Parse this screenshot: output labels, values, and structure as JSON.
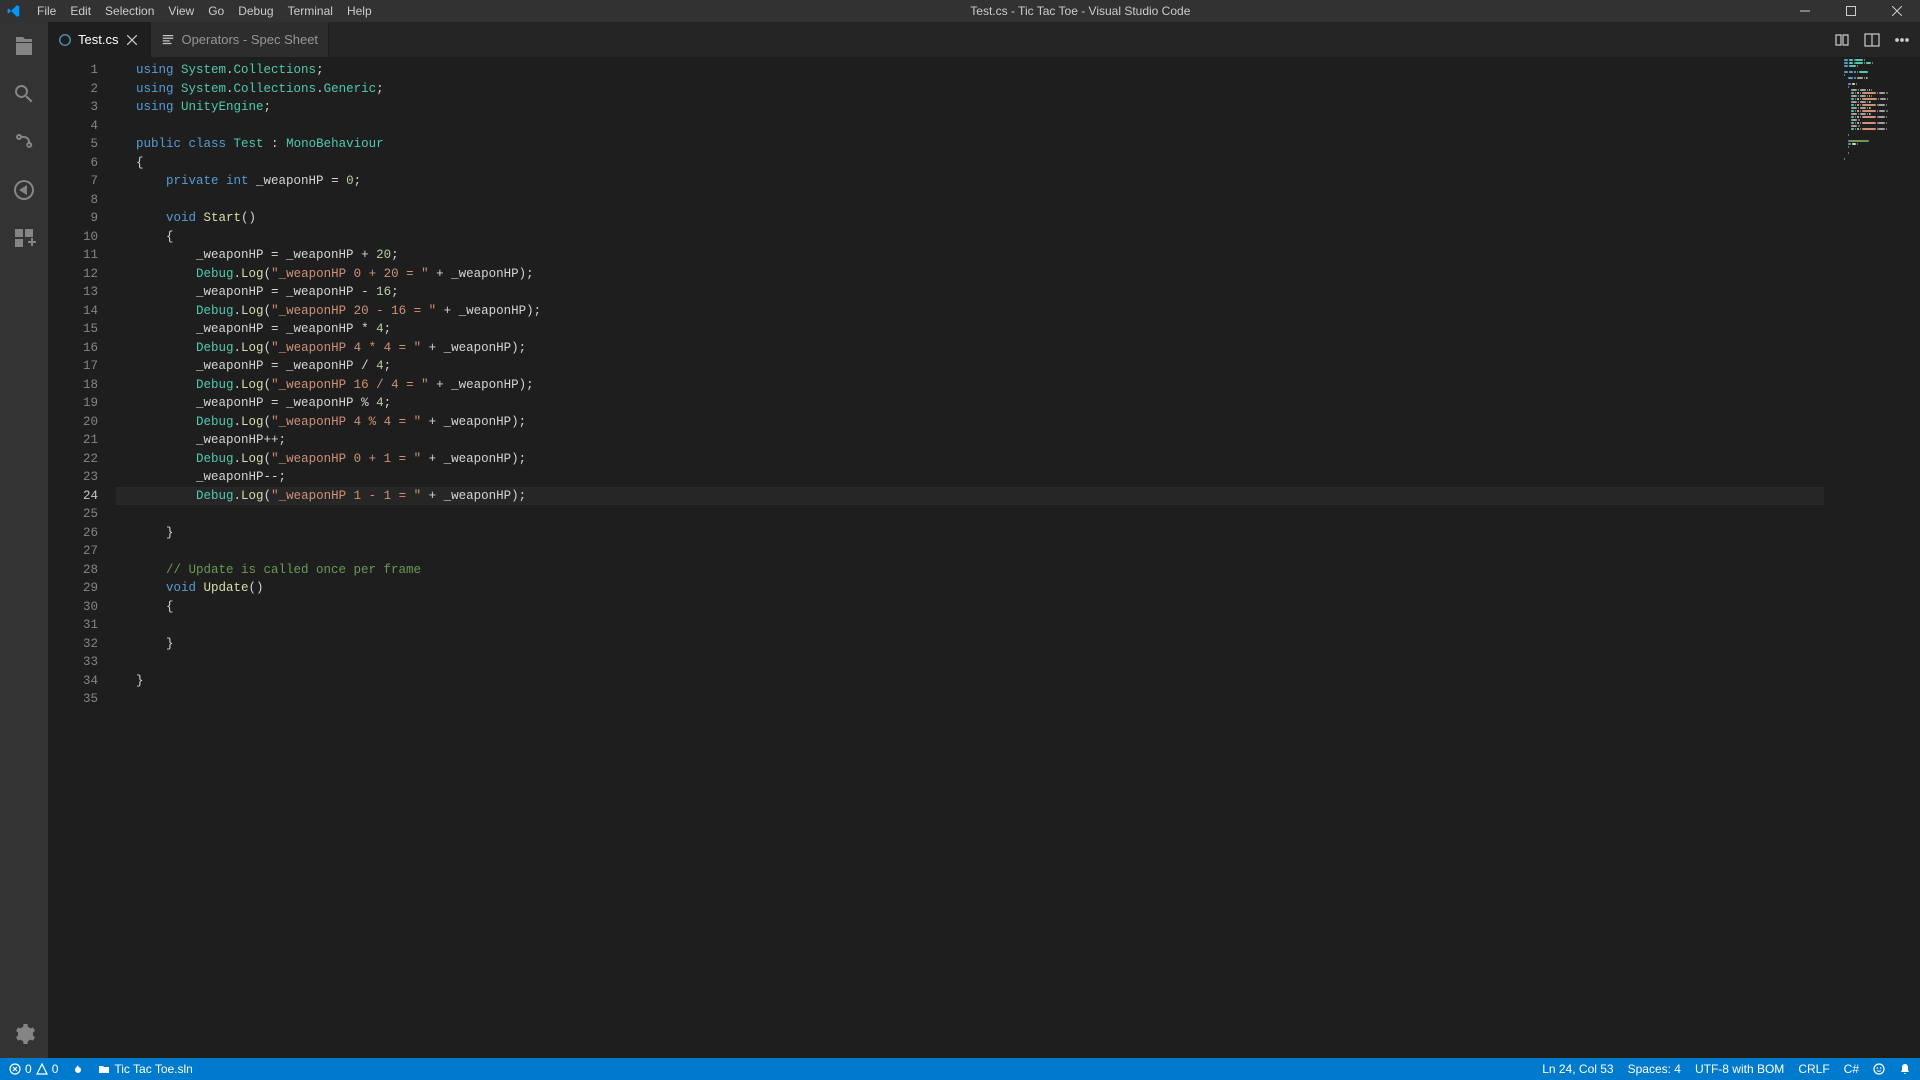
{
  "window": {
    "title": "Test.cs - Tic Tac Toe - Visual Studio Code"
  },
  "menu": {
    "file": "File",
    "edit": "Edit",
    "selection": "Selection",
    "view": "View",
    "go": "Go",
    "debug": "Debug",
    "terminal": "Terminal",
    "help": "Help"
  },
  "tabs": [
    {
      "label": "Test.cs",
      "active": true,
      "dirty": false
    },
    {
      "label": "Operators - Spec Sheet",
      "active": false,
      "dirty": false
    }
  ],
  "gutter": {
    "start": 1,
    "end": 35,
    "current": 24
  },
  "statusbar": {
    "errors": "0",
    "warnings": "0",
    "solution": "Tic Tac Toe.sln",
    "lncol": "Ln 24, Col 53",
    "spaces": "Spaces: 4",
    "encoding": "UTF-8 with BOM",
    "eol": "CRLF",
    "lang": "C#"
  },
  "code_raw": [
    "using System.Collections;",
    "using System.Collections.Generic;",
    "using UnityEngine;",
    "",
    "public class Test : MonoBehaviour",
    "{",
    "    private int _weaponHP = 0;",
    "",
    "    void Start()",
    "    {",
    "        _weaponHP = _weaponHP + 20;",
    "        Debug.Log(\"_weaponHP 0 + 20 = \" + _weaponHP);",
    "        _weaponHP = _weaponHP - 16;",
    "        Debug.Log(\"_weaponHP 20 - 16 = \" + _weaponHP);",
    "        _weaponHP = _weaponHP * 4;",
    "        Debug.Log(\"_weaponHP 4 * 4 = \" + _weaponHP);",
    "        _weaponHP = _weaponHP / 4;",
    "        Debug.Log(\"_weaponHP 16 / 4 = \" + _weaponHP);",
    "        _weaponHP = _weaponHP % 4;",
    "        Debug.Log(\"_weaponHP 4 % 4 = \" + _weaponHP);",
    "        _weaponHP++;",
    "        Debug.Log(\"_weaponHP 0 + 1 = \" + _weaponHP);",
    "        _weaponHP--;",
    "        Debug.Log(\"_weaponHP 1 - 1 = \" + _weaponHP);",
    "",
    "    }",
    "",
    "    // Update is called once per frame",
    "    void Update()",
    "    {",
    "",
    "    }",
    "",
    "}",
    ""
  ],
  "code": [
    [
      [
        "using ",
        "kw"
      ],
      [
        "System",
        "ns"
      ],
      [
        ".",
        "pun"
      ],
      [
        "Collections",
        "ns"
      ],
      [
        ";",
        "pun"
      ]
    ],
    [
      [
        "using ",
        "kw"
      ],
      [
        "System",
        "ns"
      ],
      [
        ".",
        "pun"
      ],
      [
        "Collections",
        "ns"
      ],
      [
        ".",
        "pun"
      ],
      [
        "Generic",
        "ns"
      ],
      [
        ";",
        "pun"
      ]
    ],
    [
      [
        "using ",
        "kw"
      ],
      [
        "UnityEngine",
        "ns"
      ],
      [
        ";",
        "pun"
      ]
    ],
    [],
    [
      [
        "public ",
        "kw"
      ],
      [
        "class ",
        "kw"
      ],
      [
        "Test",
        "cls"
      ],
      [
        " : ",
        "pun"
      ],
      [
        "MonoBehaviour",
        "cls"
      ]
    ],
    [
      [
        "{",
        "pun"
      ]
    ],
    [
      [
        "    ",
        "pun"
      ],
      [
        "private ",
        "kw"
      ],
      [
        "int ",
        "type"
      ],
      [
        "_weaponHP",
        "id"
      ],
      [
        " = ",
        "pun"
      ],
      [
        "0",
        "num"
      ],
      [
        ";",
        "pun"
      ]
    ],
    [],
    [
      [
        "    ",
        "pun"
      ],
      [
        "void ",
        "type"
      ],
      [
        "Start",
        "mtd"
      ],
      [
        "()",
        "pun"
      ]
    ],
    [
      [
        "    ",
        "pun"
      ],
      [
        "{",
        "pun"
      ]
    ],
    [
      [
        "        ",
        "pun"
      ],
      [
        "_weaponHP",
        "id"
      ],
      [
        " = ",
        "pun"
      ],
      [
        "_weaponHP",
        "id"
      ],
      [
        " + ",
        "pun"
      ],
      [
        "20",
        "num"
      ],
      [
        ";",
        "pun"
      ]
    ],
    [
      [
        "        ",
        "pun"
      ],
      [
        "Debug",
        "cls"
      ],
      [
        ".",
        "pun"
      ],
      [
        "Log",
        "mtd"
      ],
      [
        "(",
        "pun"
      ],
      [
        "\"_weaponHP 0 + 20 = \"",
        "str"
      ],
      [
        " + ",
        "pun"
      ],
      [
        "_weaponHP",
        "id"
      ],
      [
        ");",
        "pun"
      ]
    ],
    [
      [
        "        ",
        "pun"
      ],
      [
        "_weaponHP",
        "id"
      ],
      [
        " = ",
        "pun"
      ],
      [
        "_weaponHP",
        "id"
      ],
      [
        " - ",
        "pun"
      ],
      [
        "16",
        "num"
      ],
      [
        ";",
        "pun"
      ]
    ],
    [
      [
        "        ",
        "pun"
      ],
      [
        "Debug",
        "cls"
      ],
      [
        ".",
        "pun"
      ],
      [
        "Log",
        "mtd"
      ],
      [
        "(",
        "pun"
      ],
      [
        "\"_weaponHP 20 - 16 = \"",
        "str"
      ],
      [
        " + ",
        "pun"
      ],
      [
        "_weaponHP",
        "id"
      ],
      [
        ");",
        "pun"
      ]
    ],
    [
      [
        "        ",
        "pun"
      ],
      [
        "_weaponHP",
        "id"
      ],
      [
        " = ",
        "pun"
      ],
      [
        "_weaponHP",
        "id"
      ],
      [
        " * ",
        "pun"
      ],
      [
        "4",
        "num"
      ],
      [
        ";",
        "pun"
      ]
    ],
    [
      [
        "        ",
        "pun"
      ],
      [
        "Debug",
        "cls"
      ],
      [
        ".",
        "pun"
      ],
      [
        "Log",
        "mtd"
      ],
      [
        "(",
        "pun"
      ],
      [
        "\"_weaponHP 4 * 4 = \"",
        "str"
      ],
      [
        " + ",
        "pun"
      ],
      [
        "_weaponHP",
        "id"
      ],
      [
        ");",
        "pun"
      ]
    ],
    [
      [
        "        ",
        "pun"
      ],
      [
        "_weaponHP",
        "id"
      ],
      [
        " = ",
        "pun"
      ],
      [
        "_weaponHP",
        "id"
      ],
      [
        " / ",
        "pun"
      ],
      [
        "4",
        "num"
      ],
      [
        ";",
        "pun"
      ]
    ],
    [
      [
        "        ",
        "pun"
      ],
      [
        "Debug",
        "cls"
      ],
      [
        ".",
        "pun"
      ],
      [
        "Log",
        "mtd"
      ],
      [
        "(",
        "pun"
      ],
      [
        "\"_weaponHP 16 / 4 = \"",
        "str"
      ],
      [
        " + ",
        "pun"
      ],
      [
        "_weaponHP",
        "id"
      ],
      [
        ");",
        "pun"
      ]
    ],
    [
      [
        "        ",
        "pun"
      ],
      [
        "_weaponHP",
        "id"
      ],
      [
        " = ",
        "pun"
      ],
      [
        "_weaponHP",
        "id"
      ],
      [
        " % ",
        "pun"
      ],
      [
        "4",
        "num"
      ],
      [
        ";",
        "pun"
      ]
    ],
    [
      [
        "        ",
        "pun"
      ],
      [
        "Debug",
        "cls"
      ],
      [
        ".",
        "pun"
      ],
      [
        "Log",
        "mtd"
      ],
      [
        "(",
        "pun"
      ],
      [
        "\"_weaponHP 4 % 4 = \"",
        "str"
      ],
      [
        " + ",
        "pun"
      ],
      [
        "_weaponHP",
        "id"
      ],
      [
        ");",
        "pun"
      ]
    ],
    [
      [
        "        ",
        "pun"
      ],
      [
        "_weaponHP",
        "id"
      ],
      [
        "++;",
        "pun"
      ]
    ],
    [
      [
        "        ",
        "pun"
      ],
      [
        "Debug",
        "cls"
      ],
      [
        ".",
        "pun"
      ],
      [
        "Log",
        "mtd"
      ],
      [
        "(",
        "pun"
      ],
      [
        "\"_weaponHP 0 + 1 = \"",
        "str"
      ],
      [
        " + ",
        "pun"
      ],
      [
        "_weaponHP",
        "id"
      ],
      [
        ");",
        "pun"
      ]
    ],
    [
      [
        "        ",
        "pun"
      ],
      [
        "_weaponHP",
        "id"
      ],
      [
        "--;",
        "pun"
      ]
    ],
    [
      [
        "        ",
        "pun"
      ],
      [
        "Debug",
        "cls"
      ],
      [
        ".",
        "pun"
      ],
      [
        "Log",
        "mtd"
      ],
      [
        "(",
        "pun"
      ],
      [
        "\"_weaponHP 1 - 1 = \"",
        "str"
      ],
      [
        " + ",
        "pun"
      ],
      [
        "_weaponHP",
        "id"
      ],
      [
        ");",
        "pun"
      ]
    ],
    [],
    [
      [
        "    ",
        "pun"
      ],
      [
        "}",
        "pun"
      ]
    ],
    [],
    [
      [
        "    ",
        "pun"
      ],
      [
        "// Update is called once per frame",
        "cmt"
      ]
    ],
    [
      [
        "    ",
        "pun"
      ],
      [
        "void ",
        "type"
      ],
      [
        "Update",
        "mtd"
      ],
      [
        "()",
        "pun"
      ]
    ],
    [
      [
        "    ",
        "pun"
      ],
      [
        "{",
        "pun"
      ]
    ],
    [],
    [
      [
        "    ",
        "pun"
      ],
      [
        "}",
        "pun"
      ]
    ],
    [],
    [
      [
        "}",
        "pun"
      ]
    ],
    []
  ]
}
